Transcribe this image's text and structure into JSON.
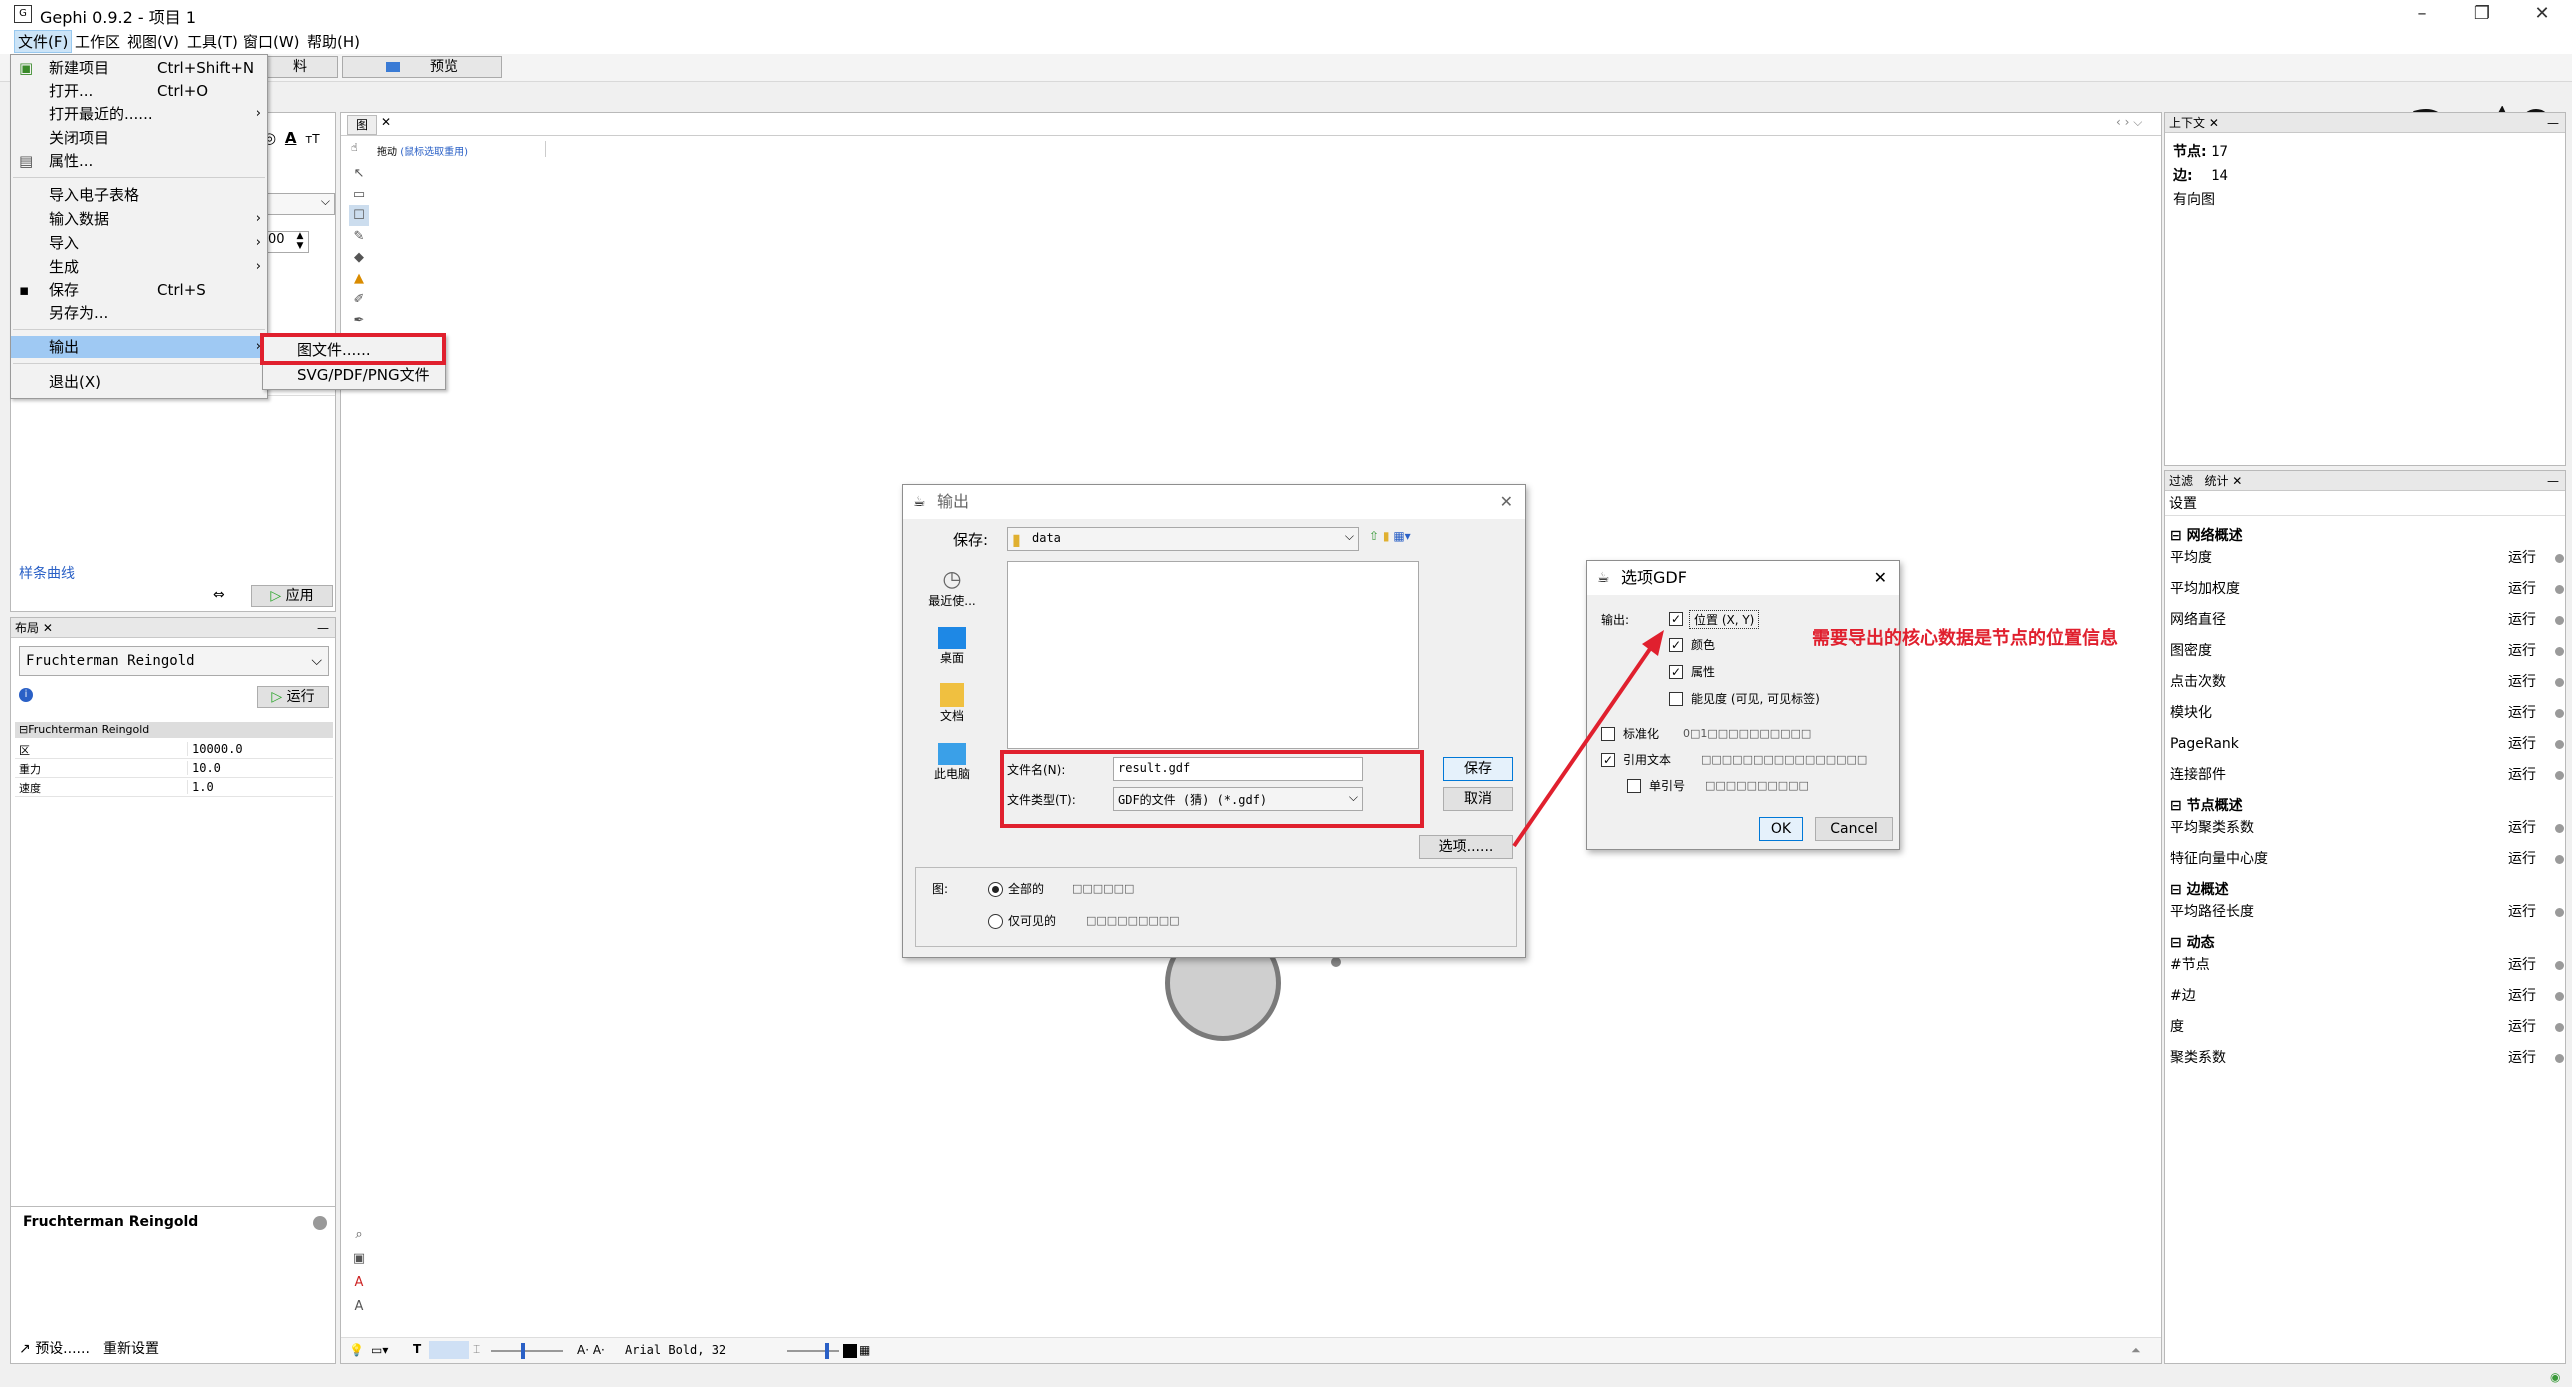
{
  "window": {
    "title": "Gephi 0.9.2 - 项目 1",
    "app_icon": "gephi-icon"
  },
  "menubar": [
    "文件(F)",
    "工作区",
    "视图(V)",
    "工具(T)",
    "窗口(W)",
    "帮助(H)"
  ],
  "toolbar": {
    "tab_data": "料",
    "tab_preview": "预览"
  },
  "file_menu": {
    "items": [
      {
        "label": "新建项目",
        "accel": "Ctrl+Shift+N"
      },
      {
        "label": "打开...",
        "accel": "Ctrl+O"
      },
      {
        "label": "打开最近的......",
        "accel": ""
      },
      {
        "label": "关闭项目",
        "accel": ""
      },
      {
        "label": "属性...",
        "accel": ""
      },
      {
        "label": "导入电子表格",
        "accel": ""
      },
      {
        "label": "输入数据",
        "accel": ""
      },
      {
        "label": "导入",
        "accel": ""
      },
      {
        "label": "生成",
        "accel": ""
      },
      {
        "label": "保存",
        "accel": "Ctrl+S"
      },
      {
        "label": "另存为...",
        "accel": ""
      },
      {
        "label": "输出",
        "accel": ""
      },
      {
        "label": "退出(X)",
        "accel": ""
      }
    ]
  },
  "export_submenu": [
    "图文件......",
    "SVG/PDF/PNG文件"
  ],
  "left_panel": {
    "spline_tab": "样条曲线",
    "apply": "应用",
    "spinner_value": "00",
    "layout_tab": "布局",
    "layout_algo": "Fruchterman Reingold",
    "run": "运行",
    "props_header": "Fruchterman Reingold",
    "props": [
      {
        "k": "区",
        "v": "10000.0"
      },
      {
        "k": "重力",
        "v": "10.0"
      },
      {
        "k": "速度",
        "v": "1.0"
      }
    ],
    "desc_title": "Fruchterman Reingold",
    "presets": "预设......",
    "reset": "重新设置"
  },
  "graph_panel": {
    "tab": "图",
    "hint_label": "拖动",
    "hint": "(鼠标选取重用)",
    "font_label": "Arial Bold, 32"
  },
  "export_dialog": {
    "title": "输出",
    "save_in_label": "保存:",
    "save_in_value": "data",
    "places": [
      "最近使...",
      "桌面",
      "文档",
      "此电脑"
    ],
    "filename_label": "文件名(N):",
    "filename_value": "result.gdf",
    "filetype_label": "文件类型(T):",
    "filetype_value": "GDF的文件 (猜) (*.gdf)",
    "save": "保存",
    "cancel": "取消",
    "options": "选项......",
    "graph_label": "图:",
    "radio_all": "全部的",
    "radio_visible": "仅可见的",
    "radio_all_note": "□□□□□□",
    "radio_visible_note": "□□□□□□□□□"
  },
  "gdf_dialog": {
    "title": "选项GDF",
    "export_label": "输出:",
    "cb_position": "位置 (X, Y)",
    "cb_color": "颜色",
    "cb_attributes": "属性",
    "cb_visibility": "能见度 (可见, 可见标签)",
    "normalize": "标准化",
    "normalize_note": "0□1□□□□□□□□□□",
    "quote_text": "引用文本",
    "quote_note": "□□□□□□□□□□□□□□□□",
    "single_quote": "单引号",
    "single_note": "□□□□□□□□□□",
    "ok": "OK",
    "cancel": "Cancel"
  },
  "annotation": "需要导出的核心数据是节点的位置信息",
  "context_panel": {
    "tab": "上下文",
    "nodes_label": "节点:",
    "nodes": "17",
    "edges_label": "边:",
    "edges": "14",
    "type": "有向图"
  },
  "stats_panel": {
    "tab_filter": "过滤",
    "tab_stats": "统计",
    "settings": "设置",
    "run": "运行",
    "cat_network": "网络概述",
    "cat_node": "节点概述",
    "cat_edge": "边概述",
    "cat_dynamic": "动态",
    "network": [
      "平均度",
      "平均加权度",
      "网络直径",
      "图密度",
      "点击次数",
      "模块化",
      "PageRank",
      "连接部件"
    ],
    "node": [
      "平均聚类系数",
      "特征向量中心度"
    ],
    "edge": [
      "平均路径长度"
    ],
    "dynamic": [
      "#节点",
      "#边",
      "度",
      "聚类系数"
    ]
  },
  "colors": {
    "highlight": "#9fc9f3",
    "annotation_red": "#e0202e"
  }
}
